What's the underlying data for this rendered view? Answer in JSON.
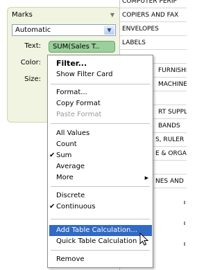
{
  "marks": {
    "title": "Marks",
    "mark_type": "Automatic",
    "shelves": [
      {
        "label": "Text:"
      },
      {
        "label": "Color:"
      },
      {
        "label": "Size:"
      }
    ],
    "text_pill": "SUM(Sales T.."
  },
  "table_rows": [
    "COMPUTER PERIP",
    "COPIERS AND FAX",
    "ENVELOPES",
    "LABELS",
    "",
    "FURNISHIN",
    "MACHINES",
    "",
    "RT SUPPL",
    "BANDS",
    "S, RULER",
    "E & ORGA",
    "",
    "NES AND"
  ],
  "menu": {
    "filter": "Filter...",
    "show_filter_card": "Show Filter Card",
    "format": "Format...",
    "copy_format": "Copy Format",
    "paste_format": "Paste Format",
    "all_values": "All Values",
    "count": "Count",
    "sum": "Sum",
    "average": "Average",
    "more": "More",
    "discrete": "Discrete",
    "continuous": "Continuous",
    "add_table_calc": "Add Table Calculation...",
    "quick_table_calc": "Quick Table Calculation",
    "remove": "Remove",
    "check_glyph": "✔",
    "submenu_glyph": "▶"
  },
  "colors": {
    "highlight": "#316ac5",
    "pill": "#9bcf9b",
    "card_bg": "#f1f4e1"
  }
}
